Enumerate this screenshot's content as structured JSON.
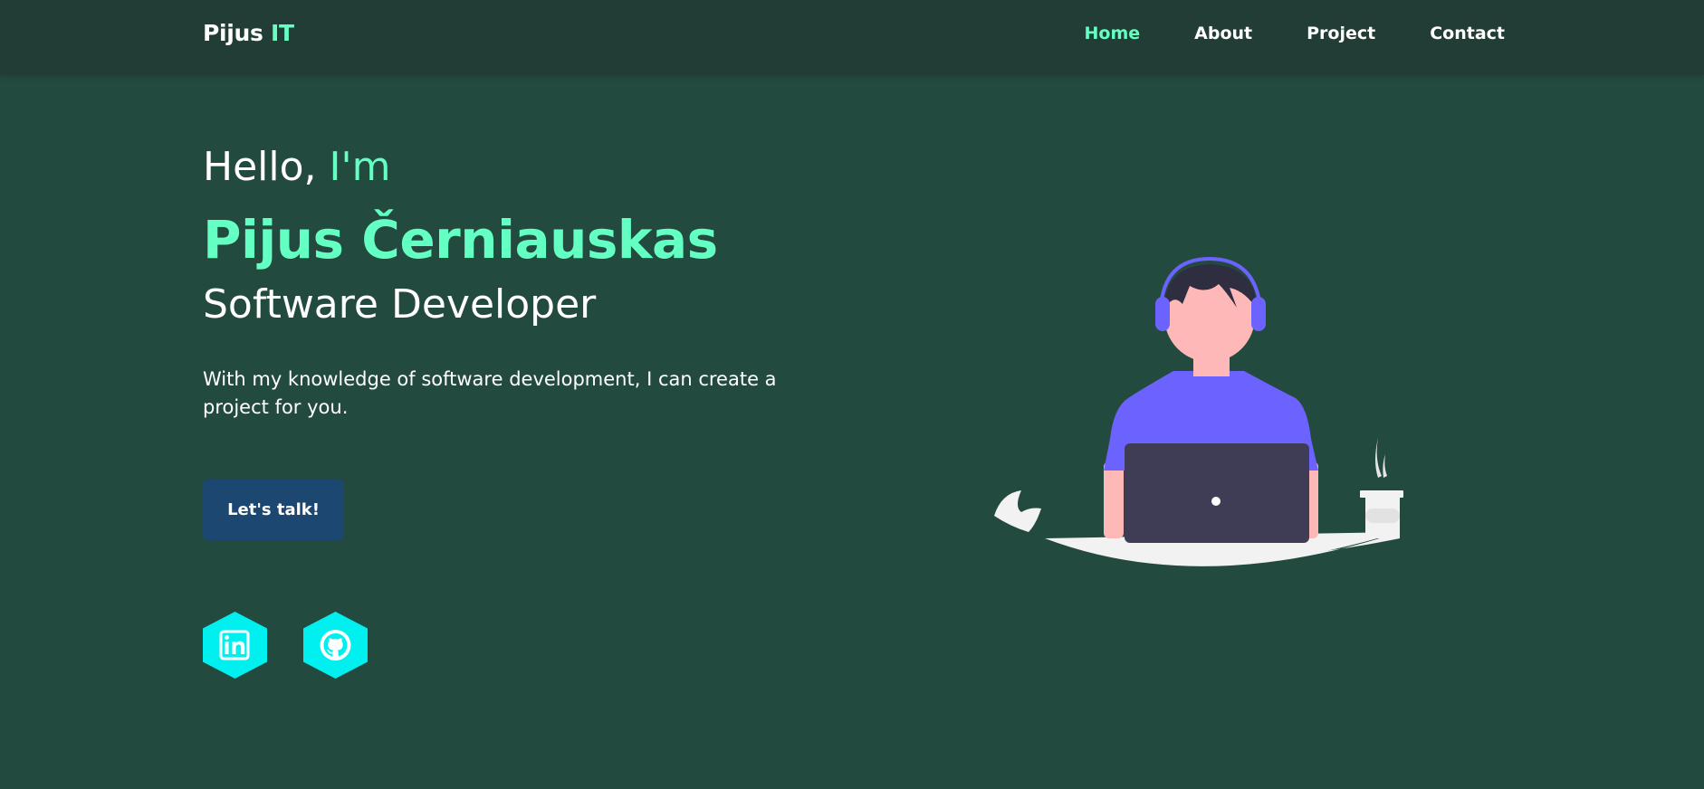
{
  "brand": {
    "name": "Pijus",
    "accent": "IT"
  },
  "nav": {
    "items": [
      {
        "label": "Home",
        "active": true
      },
      {
        "label": "About",
        "active": false
      },
      {
        "label": "Project",
        "active": false
      },
      {
        "label": "Contact",
        "active": false
      }
    ]
  },
  "hero": {
    "greeting": "Hello,",
    "greeting_accent": "I'm",
    "name": "Pijus Černiauskas",
    "role": "Software Developer",
    "tagline": "With my knowledge of software development, I can create a project for you.",
    "cta_label": "Let's talk!"
  },
  "socials": [
    {
      "name": "linkedin-icon",
      "glyph": "in"
    },
    {
      "name": "github-icon"
    }
  ],
  "colors": {
    "background": "#234a3e",
    "navbar": "#223d35",
    "accent": "#64ffc3",
    "button": "#1c4770",
    "social": "#00f0f0",
    "figure_shirt": "#6c63ff",
    "laptop": "#3f3d56",
    "skin": "#ffb8b8",
    "desk": "#f2f2f2"
  }
}
